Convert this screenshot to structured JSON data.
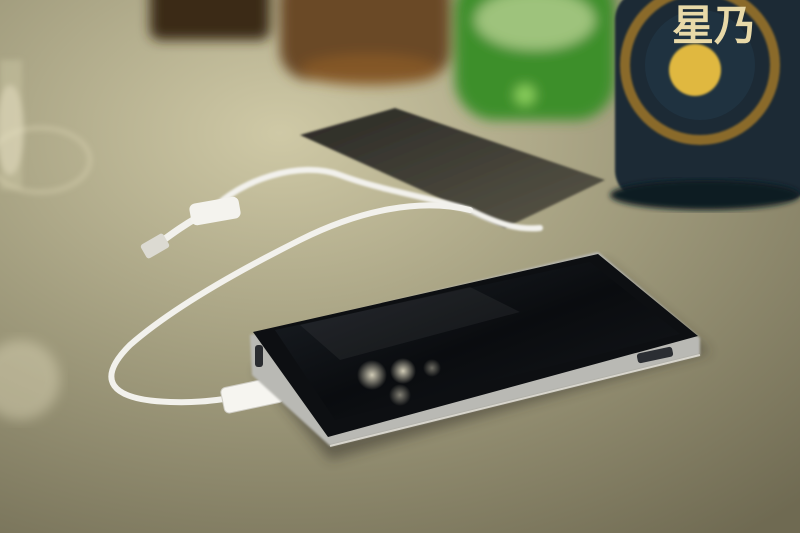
{
  "photo": {
    "bottle_label_text": "星乃"
  },
  "colors": {
    "counter": "#9b9678",
    "counter_highlight": "#c8c3a0",
    "phone_body": "#0d0f12",
    "phone_rim": "#b9b9b4",
    "cable": "#f2f1ec",
    "bottle_glass": "#1c2a34",
    "green_bottle": "#3c8f2a",
    "amber_bottle": "#7a4a1c"
  },
  "icons": [
    "smartphone-icon",
    "usb-cable-icon",
    "usb-connector-icon",
    "sake-bottle-icon",
    "wine-glass-icon"
  ]
}
